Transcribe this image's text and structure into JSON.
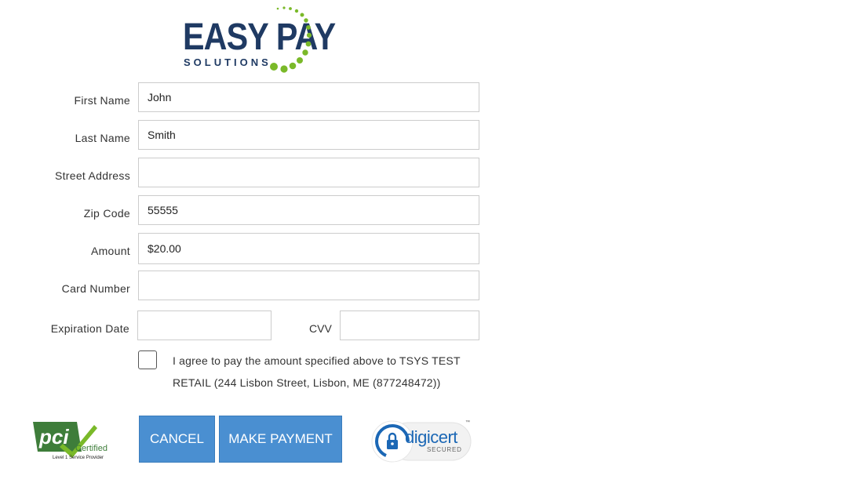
{
  "brand": {
    "name": "EASY PAY",
    "sub": "SOLUTIONS",
    "navy": "#1f3a63",
    "green": "#7ab929"
  },
  "form": {
    "first_name": {
      "label": "First Name",
      "value": "John"
    },
    "last_name": {
      "label": "Last Name",
      "value": "Smith"
    },
    "street": {
      "label": "Street Address",
      "value": ""
    },
    "zip": {
      "label": "Zip Code",
      "value": "55555"
    },
    "amount": {
      "label": "Amount",
      "value": "$20.00"
    },
    "card": {
      "label": "Card Number",
      "value": ""
    },
    "expiration": {
      "label": "Expiration Date",
      "value": ""
    },
    "cvv": {
      "label": "CVV",
      "value": ""
    },
    "agree_text": "I agree to pay the amount specified above to TSYS TEST RETAIL (244 Lisbon Street, Lisbon, ME (877248472))"
  },
  "buttons": {
    "cancel": "CANCEL",
    "make_payment": "MAKE PAYMENT",
    "color": "#4a8fd1"
  },
  "badges": {
    "pci": {
      "main": "pci",
      "certified": "Certified",
      "sub": "Level 1 Service Provider"
    },
    "digicert": {
      "name": "digicert",
      "tm": "™",
      "secured": "SECURED"
    }
  }
}
